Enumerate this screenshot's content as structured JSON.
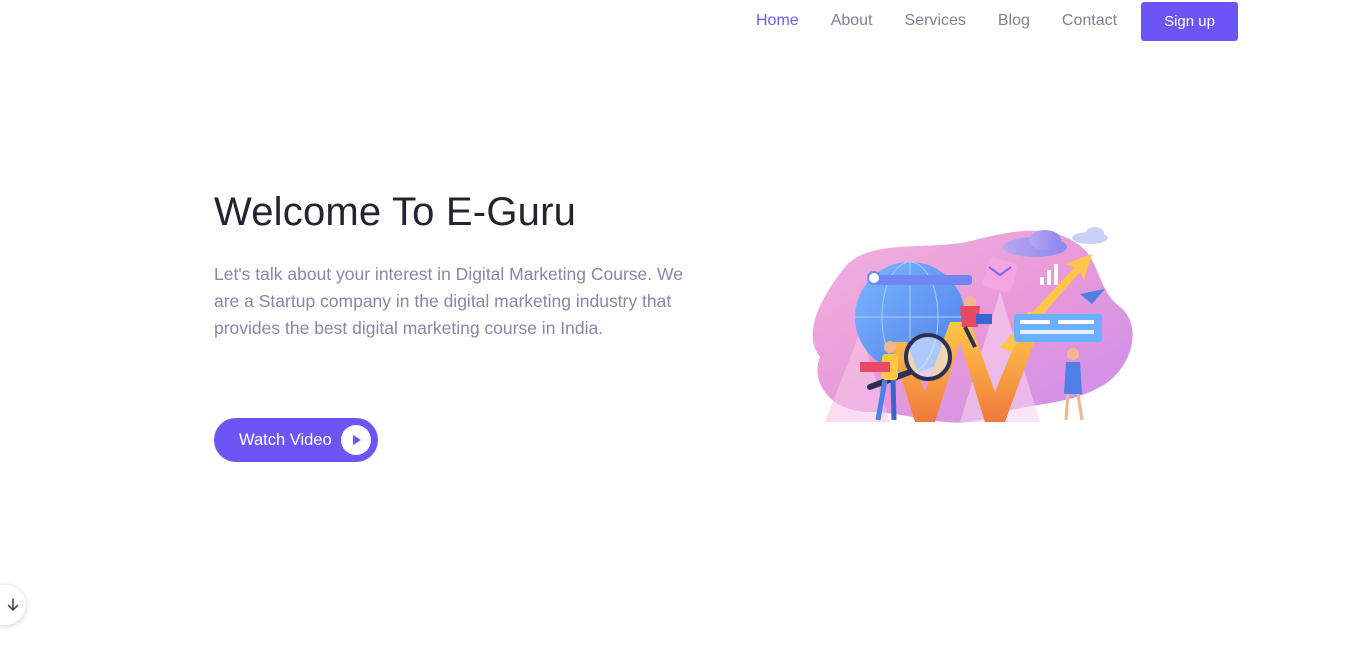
{
  "nav": {
    "items": [
      {
        "label": "Home",
        "active": true
      },
      {
        "label": "About",
        "active": false
      },
      {
        "label": "Services",
        "active": false
      },
      {
        "label": "Blog",
        "active": false
      },
      {
        "label": "Contact",
        "active": false
      }
    ],
    "signup_label": "Sign up"
  },
  "hero": {
    "title": "Welcome To E-Guru",
    "text": "Let's talk about your interest in Digital Marketing Course. We are a Startup company in the digital marketing industry that provides the best digital marketing course in India.",
    "watch_label": "Watch Video"
  },
  "icons": {
    "play": "play-icon",
    "scroll": "arrow-down-icon"
  },
  "colors": {
    "accent": "#6b55f5",
    "nav_active": "#6a5cf6",
    "nav_text": "#808093",
    "title": "#25232f",
    "body_text": "#8a86a8"
  }
}
